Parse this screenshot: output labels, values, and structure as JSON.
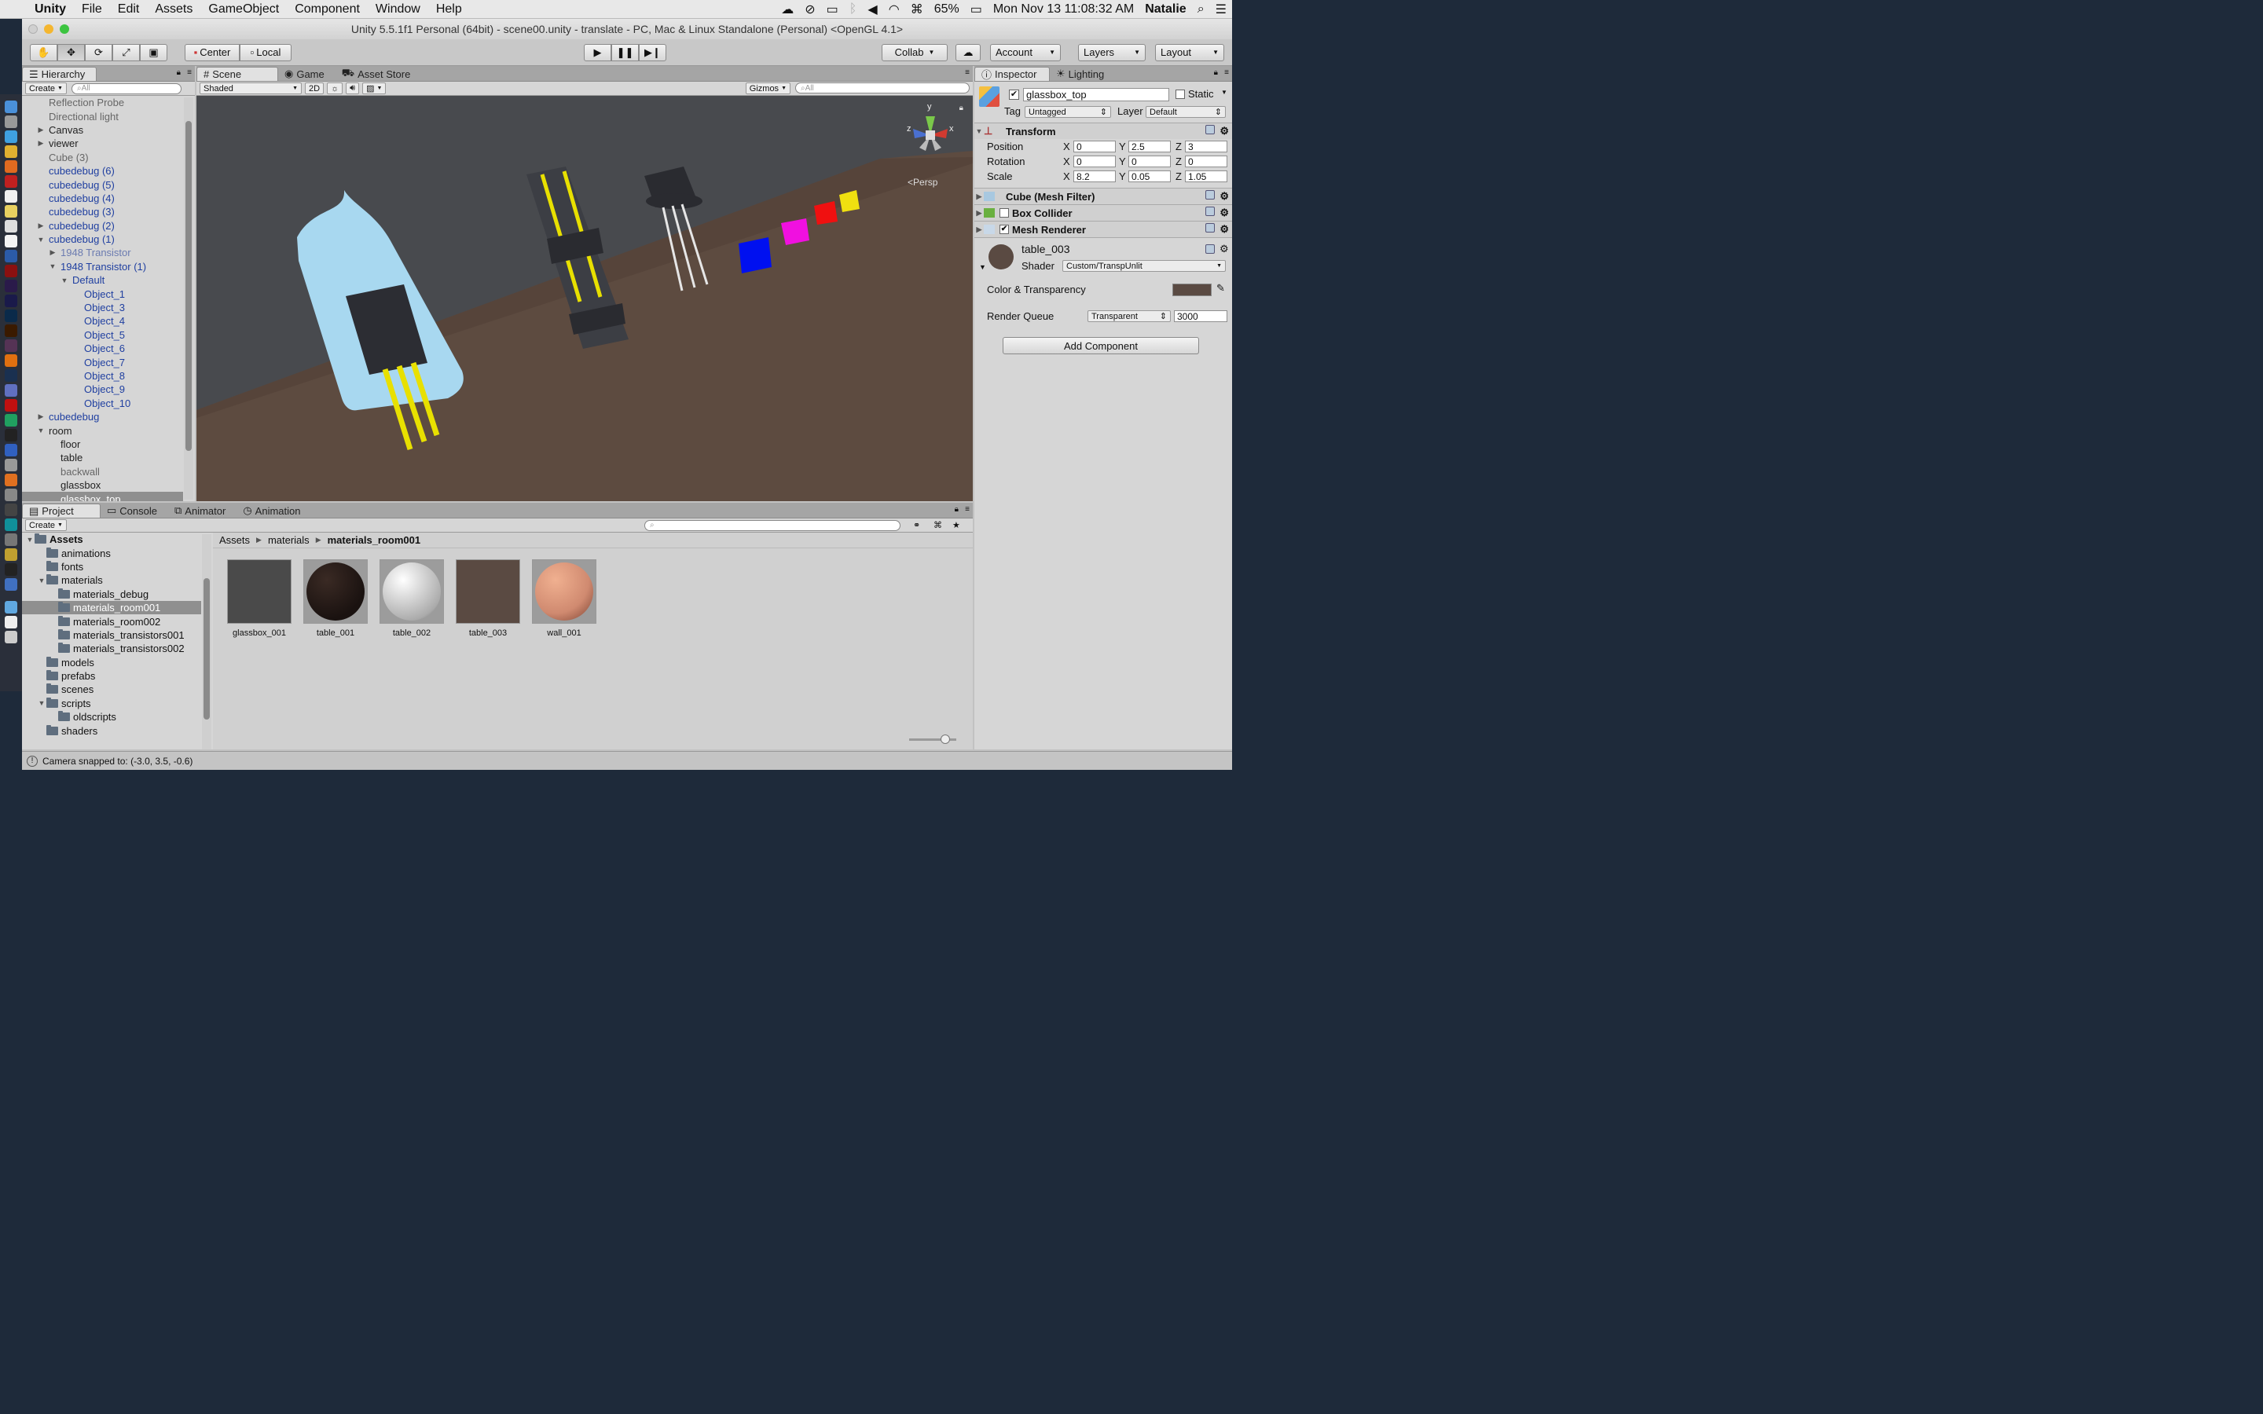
{
  "menubar": {
    "app": "Unity",
    "items": [
      "File",
      "Edit",
      "Assets",
      "GameObject",
      "Component",
      "Window",
      "Help"
    ],
    "battery": "65%",
    "datetime": "Mon Nov 13  11:08:32 AM",
    "user": "Natalie"
  },
  "window": {
    "title": "Unity 5.5.1f1 Personal (64bit) - scene00.unity - translate - PC, Mac & Linux Standalone (Personal) <OpenGL 4.1>"
  },
  "toolbar": {
    "pivot_center": "Center",
    "pivot_local": "Local",
    "collab": "Collab",
    "account": "Account",
    "layers": "Layers",
    "layout": "Layout"
  },
  "hierarchy": {
    "tab": "Hierarchy",
    "create": "Create",
    "search_placeholder": "All",
    "rows": [
      {
        "label": "Reflection Probe",
        "indent": 0,
        "arrow": "",
        "style": "dim"
      },
      {
        "label": "Directional light",
        "indent": 0,
        "arrow": "",
        "style": "dim"
      },
      {
        "label": "Canvas",
        "indent": 0,
        "arrow": "right",
        "style": ""
      },
      {
        "label": "viewer",
        "indent": 0,
        "arrow": "right",
        "style": ""
      },
      {
        "label": "Cube (3)",
        "indent": 0,
        "arrow": "",
        "style": "dim"
      },
      {
        "label": "cubedebug (6)",
        "indent": 0,
        "arrow": "",
        "style": "prefab"
      },
      {
        "label": "cubedebug (5)",
        "indent": 0,
        "arrow": "",
        "style": "prefab"
      },
      {
        "label": "cubedebug (4)",
        "indent": 0,
        "arrow": "",
        "style": "prefab"
      },
      {
        "label": "cubedebug (3)",
        "indent": 0,
        "arrow": "",
        "style": "prefab"
      },
      {
        "label": "cubedebug (2)",
        "indent": 0,
        "arrow": "right",
        "style": "prefab"
      },
      {
        "label": "cubedebug (1)",
        "indent": 0,
        "arrow": "down",
        "style": "prefab"
      },
      {
        "label": "1948 Transistor",
        "indent": 1,
        "arrow": "right",
        "style": "dimprefab"
      },
      {
        "label": "1948 Transistor (1)",
        "indent": 1,
        "arrow": "down",
        "style": "prefab"
      },
      {
        "label": "Default",
        "indent": 2,
        "arrow": "down",
        "style": "prefab"
      },
      {
        "label": "Object_1",
        "indent": 3,
        "arrow": "",
        "style": "prefab"
      },
      {
        "label": "Object_3",
        "indent": 3,
        "arrow": "",
        "style": "prefab"
      },
      {
        "label": "Object_4",
        "indent": 3,
        "arrow": "",
        "style": "prefab"
      },
      {
        "label": "Object_5",
        "indent": 3,
        "arrow": "",
        "style": "prefab"
      },
      {
        "label": "Object_6",
        "indent": 3,
        "arrow": "",
        "style": "prefab"
      },
      {
        "label": "Object_7",
        "indent": 3,
        "arrow": "",
        "style": "prefab"
      },
      {
        "label": "Object_8",
        "indent": 3,
        "arrow": "",
        "style": "prefab"
      },
      {
        "label": "Object_9",
        "indent": 3,
        "arrow": "",
        "style": "prefab"
      },
      {
        "label": "Object_10",
        "indent": 3,
        "arrow": "",
        "style": "prefab"
      },
      {
        "label": "cubedebug",
        "indent": 0,
        "arrow": "right",
        "style": "prefab"
      },
      {
        "label": "room",
        "indent": 0,
        "arrow": "down",
        "style": ""
      },
      {
        "label": "floor",
        "indent": 1,
        "arrow": "",
        "style": ""
      },
      {
        "label": "table",
        "indent": 1,
        "arrow": "",
        "style": ""
      },
      {
        "label": "backwall",
        "indent": 1,
        "arrow": "",
        "style": "dim"
      },
      {
        "label": "glassbox",
        "indent": 1,
        "arrow": "",
        "style": ""
      },
      {
        "label": "glassbox_top",
        "indent": 1,
        "arrow": "",
        "style": "sel"
      }
    ]
  },
  "scene": {
    "tabs": [
      "Scene",
      "Game",
      "Asset Store"
    ],
    "shading": "Shaded",
    "mode_2d": "2D",
    "gizmos": "Gizmos",
    "search_placeholder": "All",
    "persp": "Persp",
    "axis_y": "y",
    "axis_x": "x",
    "axis_z": "z"
  },
  "inspector": {
    "tabs": [
      "Inspector",
      "Lighting"
    ],
    "object_name": "glassbox_top",
    "static": "Static",
    "tag_label": "Tag",
    "tag": "Untagged",
    "layer_label": "Layer",
    "layer": "Default",
    "transform": {
      "title": "Transform",
      "position_label": "Position",
      "rotation_label": "Rotation",
      "scale_label": "Scale",
      "position": {
        "x": "0",
        "y": "2.5",
        "z": "3"
      },
      "rotation": {
        "x": "0",
        "y": "0",
        "z": "0"
      },
      "scale": {
        "x": "8.2",
        "y": "0.05",
        "z": "1.05"
      }
    },
    "components": [
      "Cube (Mesh Filter)",
      "Box Collider",
      "Mesh Renderer"
    ],
    "material": {
      "name": "table_003",
      "shader_label": "Shader",
      "shader": "Custom/TranspUnlit",
      "color_label": "Color & Transparency",
      "queue_label": "Render Queue",
      "queue_mode": "Transparent",
      "queue_value": "3000",
      "swatch": "#5a4a42"
    },
    "add_component": "Add Component"
  },
  "project": {
    "tabs": [
      "Project",
      "Console",
      "Animator",
      "Animation"
    ],
    "create": "Create",
    "tree": [
      {
        "label": "Assets",
        "indent": 0,
        "arrow": "down",
        "bold": true
      },
      {
        "label": "animations",
        "indent": 1,
        "arrow": ""
      },
      {
        "label": "fonts",
        "indent": 1,
        "arrow": ""
      },
      {
        "label": "materials",
        "indent": 1,
        "arrow": "down"
      },
      {
        "label": "materials_debug",
        "indent": 2,
        "arrow": ""
      },
      {
        "label": "materials_room001",
        "indent": 2,
        "arrow": "",
        "sel": true
      },
      {
        "label": "materials_room002",
        "indent": 2,
        "arrow": ""
      },
      {
        "label": "materials_transistors001",
        "indent": 2,
        "arrow": ""
      },
      {
        "label": "materials_transistors002",
        "indent": 2,
        "arrow": ""
      },
      {
        "label": "models",
        "indent": 1,
        "arrow": ""
      },
      {
        "label": "prefabs",
        "indent": 1,
        "arrow": ""
      },
      {
        "label": "scenes",
        "indent": 1,
        "arrow": ""
      },
      {
        "label": "scripts",
        "indent": 1,
        "arrow": "down"
      },
      {
        "label": "oldscripts",
        "indent": 2,
        "arrow": ""
      },
      {
        "label": "shaders",
        "indent": 1,
        "arrow": ""
      }
    ],
    "breadcrumb": [
      "Assets",
      "materials",
      "materials_room001"
    ],
    "assets": [
      {
        "name": "glassbox_001",
        "color": "#4a4a4a",
        "kind": "flat"
      },
      {
        "name": "table_001",
        "color": "#1a1210",
        "kind": "dark"
      },
      {
        "name": "table_002",
        "color": "#e8e8e8",
        "kind": "white"
      },
      {
        "name": "table_003",
        "color": "#5a4a42",
        "kind": "flat"
      },
      {
        "name": "wall_001",
        "color": "#d08a70",
        "kind": "salmon"
      }
    ]
  },
  "status": {
    "text": "Camera snapped to: (-3.0, 3.5, -0.6)"
  }
}
